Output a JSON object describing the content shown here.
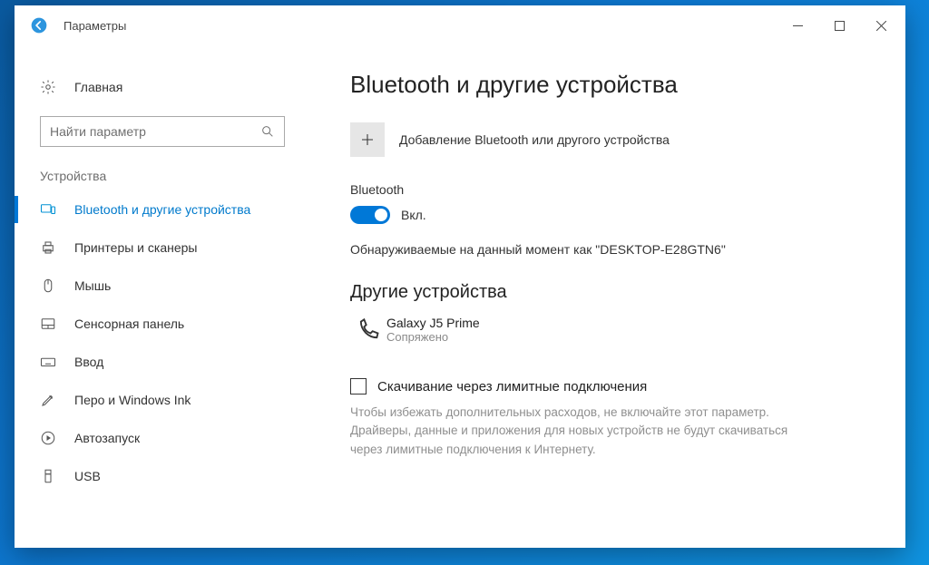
{
  "titlebar": {
    "app_title": "Параметры"
  },
  "sidebar": {
    "home_label": "Главная",
    "search_placeholder": "Найти параметр",
    "category_label": "Устройства",
    "items": [
      {
        "label": "Bluetooth и другие устройства",
        "active": true
      },
      {
        "label": "Принтеры и сканеры"
      },
      {
        "label": "Мышь"
      },
      {
        "label": "Сенсорная панель"
      },
      {
        "label": "Ввод"
      },
      {
        "label": "Перо и Windows Ink"
      },
      {
        "label": "Автозапуск"
      },
      {
        "label": "USB"
      }
    ]
  },
  "content": {
    "page_title": "Bluetooth и другие устройства",
    "add_device_label": "Добавление Bluetooth или другого устройства",
    "bluetooth_section_label": "Bluetooth",
    "toggle_state_label": "Вкл.",
    "discoverable_text": "Обнаруживаемые на данный момент как \"DESKTOP-E28GTN6\"",
    "other_devices_title": "Другие устройства",
    "device": {
      "name": "Galaxy J5 Prime",
      "status": "Сопряжено"
    },
    "metered_checkbox_label": "Скачивание через лимитные подключения",
    "metered_hint": "Чтобы избежать дополнительных расходов, не включайте этот параметр. Драйверы, данные и приложения для новых устройств не будут скачиваться через лимитные подключения к Интернету."
  }
}
